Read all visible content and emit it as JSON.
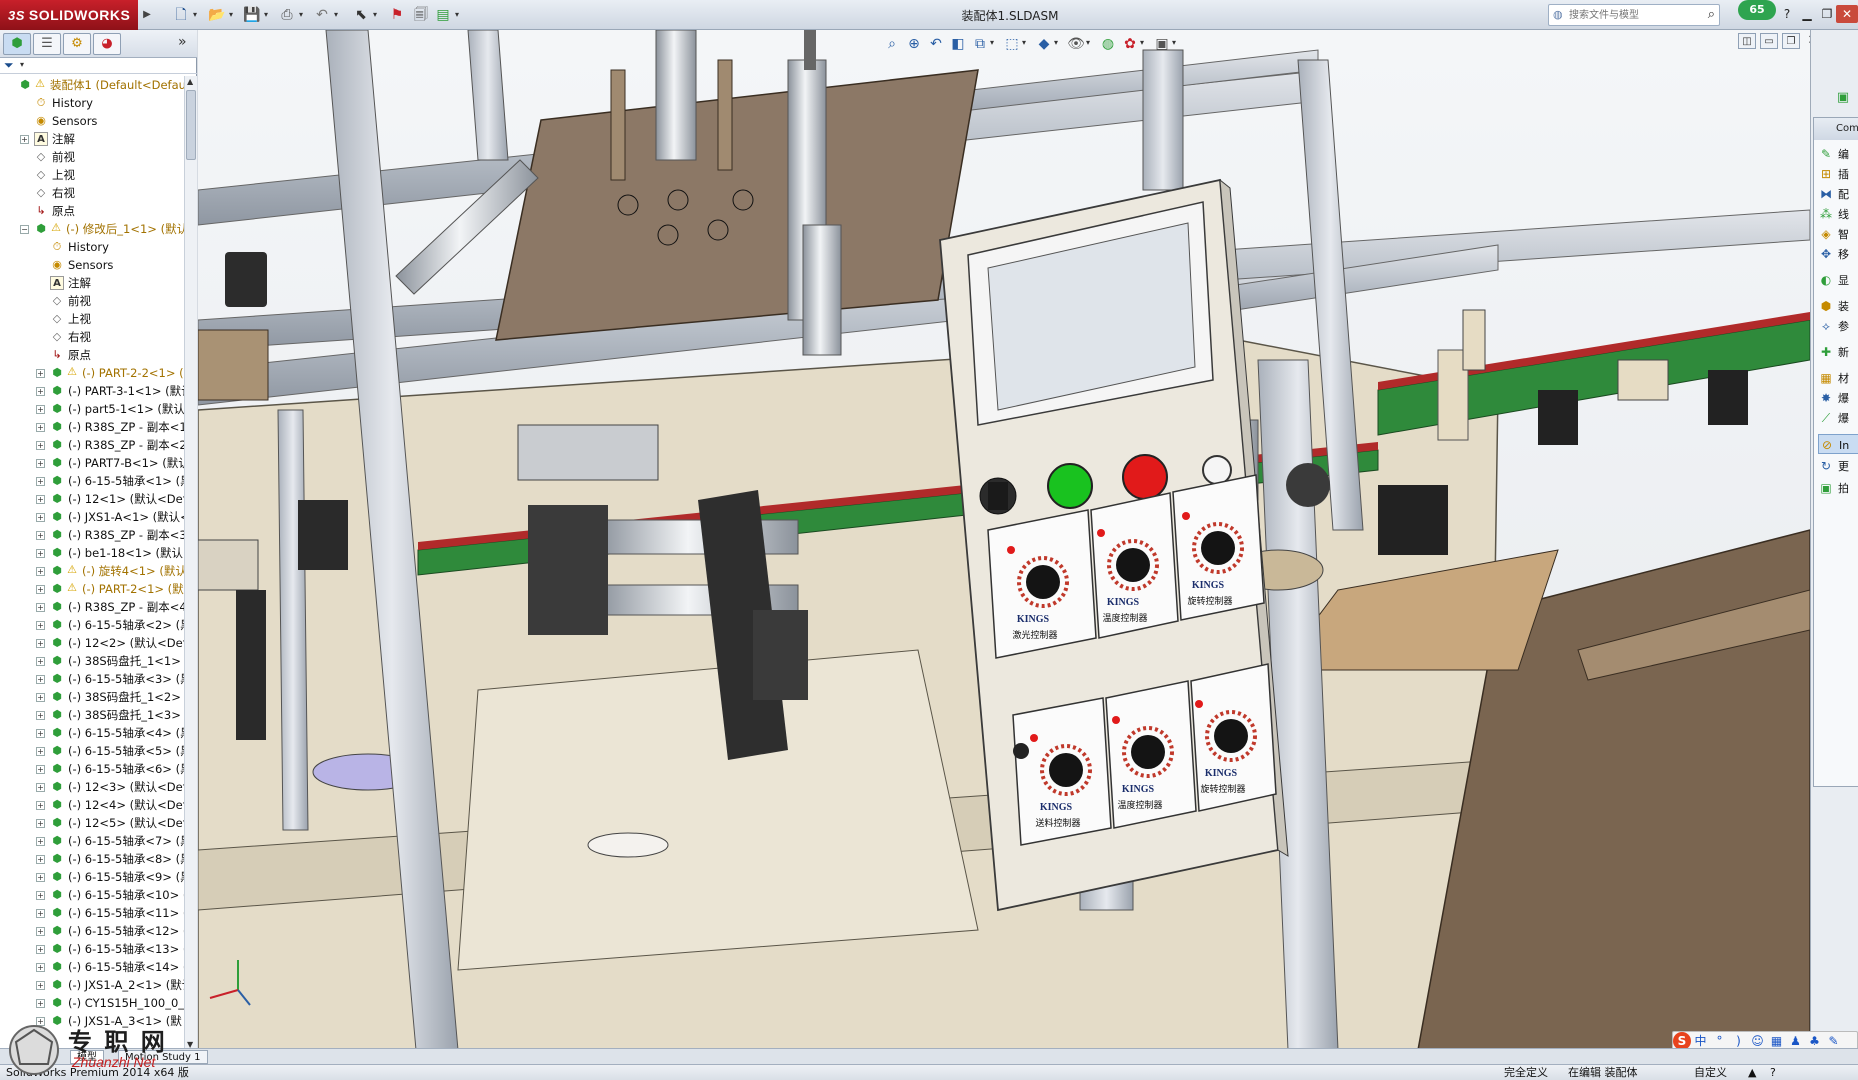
{
  "app": {
    "brand": "SOLIDWORKS",
    "brand_prefix": "3S",
    "document_title": "装配体1.SLDASM",
    "notification_count": "65"
  },
  "search": {
    "placeholder": "搜索文件与模型"
  },
  "tree": {
    "root_label": "装配体1  (Default<Defaul",
    "items": [
      {
        "label": "History",
        "icon": "history-icon",
        "level": 1,
        "expand": false
      },
      {
        "label": "Sensors",
        "icon": "sensors-icon",
        "level": 1,
        "expand": false
      },
      {
        "label": "注解",
        "icon": "annotation-icon",
        "level": 1,
        "expand": true
      },
      {
        "label": "前视",
        "icon": "plane-icon",
        "level": 1,
        "expand": false
      },
      {
        "label": "上视",
        "icon": "plane-icon",
        "level": 1,
        "expand": false
      },
      {
        "label": "右视",
        "icon": "plane-icon",
        "level": 1,
        "expand": false
      },
      {
        "label": "原点",
        "icon": "origin-icon",
        "level": 1,
        "expand": false
      },
      {
        "label": "(-) 修改后_1<1> (默认",
        "icon": "part-icon",
        "level": 1,
        "expand": true,
        "open": true,
        "warn": true,
        "amber": true
      },
      {
        "label": "History",
        "icon": "history-icon",
        "level": 2,
        "expand": false
      },
      {
        "label": "Sensors",
        "icon": "sensors-icon",
        "level": 2,
        "expand": false
      },
      {
        "label": "注解",
        "icon": "annotation-icon",
        "level": 2,
        "expand": false
      },
      {
        "label": "前视",
        "icon": "plane-icon",
        "level": 2,
        "expand": false
      },
      {
        "label": "上视",
        "icon": "plane-icon",
        "level": 2,
        "expand": false
      },
      {
        "label": "右视",
        "icon": "plane-icon",
        "level": 2,
        "expand": false
      },
      {
        "label": "原点",
        "icon": "origin-icon",
        "level": 2,
        "expand": false
      },
      {
        "label": "(-) PART-2-2<1> (",
        "icon": "part-icon",
        "level": 2,
        "expand": true,
        "warn": true,
        "amber": true
      },
      {
        "label": "(-) PART-3-1<1> (默认",
        "icon": "part-icon",
        "level": 2,
        "expand": true
      },
      {
        "label": "(-) part5-1<1> (默认-",
        "icon": "part-icon",
        "level": 2,
        "expand": true
      },
      {
        "label": "(-) R38S_ZP - 副本<1",
        "icon": "part-icon",
        "level": 2,
        "expand": true
      },
      {
        "label": "(-) R38S_ZP - 副本<2",
        "icon": "part-icon",
        "level": 2,
        "expand": true
      },
      {
        "label": "(-) PART7-B<1> (默认",
        "icon": "part-icon",
        "level": 2,
        "expand": true
      },
      {
        "label": "(-) 6-15-5轴承<1> (黑",
        "icon": "part-icon",
        "level": 2,
        "expand": true
      },
      {
        "label": "(-) 12<1> (默认<Defa",
        "icon": "part-icon",
        "level": 2,
        "expand": true
      },
      {
        "label": "(-) JXS1-A<1> (默认<",
        "icon": "part-icon",
        "level": 2,
        "expand": true
      },
      {
        "label": "(-) R38S_ZP - 副本<3",
        "icon": "part-icon",
        "level": 2,
        "expand": true
      },
      {
        "label": "(-) be1-18<1> (默认<",
        "icon": "part-icon",
        "level": 2,
        "expand": true
      },
      {
        "label": "(-) 旋转4<1> (默认",
        "icon": "part-icon",
        "level": 2,
        "expand": true,
        "warn": true,
        "amber": true
      },
      {
        "label": "(-) PART-2<1> (默",
        "icon": "part-icon",
        "level": 2,
        "expand": true,
        "warn": true,
        "amber": true
      },
      {
        "label": "(-) R38S_ZP - 副本<4",
        "icon": "part-icon",
        "level": 2,
        "expand": true
      },
      {
        "label": "(-) 6-15-5轴承<2> (黑",
        "icon": "part-icon",
        "level": 2,
        "expand": true
      },
      {
        "label": "(-) 12<2> (默认<Defa",
        "icon": "part-icon",
        "level": 2,
        "expand": true
      },
      {
        "label": "(-) 38S码盘托_1<1> (",
        "icon": "part-icon",
        "level": 2,
        "expand": true
      },
      {
        "label": "(-) 6-15-5轴承<3> (黑",
        "icon": "part-icon",
        "level": 2,
        "expand": true
      },
      {
        "label": "(-) 38S码盘托_1<2> (",
        "icon": "part-icon",
        "level": 2,
        "expand": true
      },
      {
        "label": "(-) 38S码盘托_1<3> (",
        "icon": "part-icon",
        "level": 2,
        "expand": true
      },
      {
        "label": "(-) 6-15-5轴承<4> (黑",
        "icon": "part-icon",
        "level": 2,
        "expand": true
      },
      {
        "label": "(-) 6-15-5轴承<5> (黑",
        "icon": "part-icon",
        "level": 2,
        "expand": true
      },
      {
        "label": "(-) 6-15-5轴承<6> (黑",
        "icon": "part-icon",
        "level": 2,
        "expand": true
      },
      {
        "label": "(-) 12<3> (默认<Defa",
        "icon": "part-icon",
        "level": 2,
        "expand": true
      },
      {
        "label": "(-) 12<4> (默认<Defa",
        "icon": "part-icon",
        "level": 2,
        "expand": true
      },
      {
        "label": "(-) 12<5> (默认<Defa",
        "icon": "part-icon",
        "level": 2,
        "expand": true
      },
      {
        "label": "(-) 6-15-5轴承<7> (黑",
        "icon": "part-icon",
        "level": 2,
        "expand": true
      },
      {
        "label": "(-) 6-15-5轴承<8> (黑",
        "icon": "part-icon",
        "level": 2,
        "expand": true
      },
      {
        "label": "(-) 6-15-5轴承<9> (黑",
        "icon": "part-icon",
        "level": 2,
        "expand": true
      },
      {
        "label": "(-) 6-15-5轴承<10> (",
        "icon": "part-icon",
        "level": 2,
        "expand": true
      },
      {
        "label": "(-) 6-15-5轴承<11> (",
        "icon": "part-icon",
        "level": 2,
        "expand": true
      },
      {
        "label": "(-) 6-15-5轴承<12> (",
        "icon": "part-icon",
        "level": 2,
        "expand": true
      },
      {
        "label": "(-) 6-15-5轴承<13> (",
        "icon": "part-icon",
        "level": 2,
        "expand": true
      },
      {
        "label": "(-) 6-15-5轴承<14> (",
        "icon": "part-icon",
        "level": 2,
        "expand": true
      },
      {
        "label": "(-) JXS1-A_2<1> (默认",
        "icon": "part-icon",
        "level": 2,
        "expand": true
      },
      {
        "label": "(-) CY1S15H_100_0_0",
        "icon": "part-icon",
        "level": 2,
        "expand": true
      },
      {
        "label": "(-) JXS1-A_3<1> (默",
        "icon": "part-icon",
        "level": 2,
        "expand": true
      }
    ]
  },
  "controller_panel": {
    "brand_label": "KINGS",
    "knob_labels": [
      "激光控制器",
      "温度控制器",
      "旋转控制器",
      "送料控制器",
      "温度控制器",
      "旋转控制器"
    ]
  },
  "task_pane": {
    "header": "Com",
    "items": [
      {
        "label": "编",
        "icon": "edit-icon"
      },
      {
        "label": "插",
        "icon": "insert-icon"
      },
      {
        "label": "配",
        "icon": "mate-icon"
      },
      {
        "label": "线",
        "icon": "pattern-icon"
      },
      {
        "label": "智",
        "icon": "smart-icon"
      },
      {
        "label": "移",
        "icon": "move-icon"
      },
      {
        "label": "显",
        "icon": "display-icon"
      },
      {
        "label": "装",
        "icon": "assembly-icon"
      },
      {
        "label": "参",
        "icon": "reference-icon"
      },
      {
        "label": "新",
        "icon": "new-icon"
      },
      {
        "label": "材",
        "icon": "material-icon"
      },
      {
        "label": "爆",
        "icon": "explode-icon"
      },
      {
        "label": "爆",
        "icon": "explode-line-icon"
      },
      {
        "label": "In",
        "icon": "interference-icon",
        "selected": true
      },
      {
        "label": "更",
        "icon": "update-icon"
      },
      {
        "label": "拍",
        "icon": "snapshot-icon"
      }
    ]
  },
  "bottom_tabs": {
    "model": "模型",
    "motion": "Motion Study 1"
  },
  "status": {
    "product": "SolidWorks Premium 2014 x64 版",
    "fully_defined": "完全定义",
    "editing": "在编辑 装配体",
    "custom": "自定义"
  },
  "ime": {
    "items": [
      "S",
      "中",
      "°",
      ")",
      "☺",
      "▦",
      "♟",
      "♣",
      "✎"
    ]
  },
  "watermark": {
    "text": "专 职 网",
    "url": "Zhuanzhi Net"
  },
  "colors": {
    "accent": "#c8202a",
    "panel": "#e9e4d6",
    "frame": "#c9ced6"
  }
}
